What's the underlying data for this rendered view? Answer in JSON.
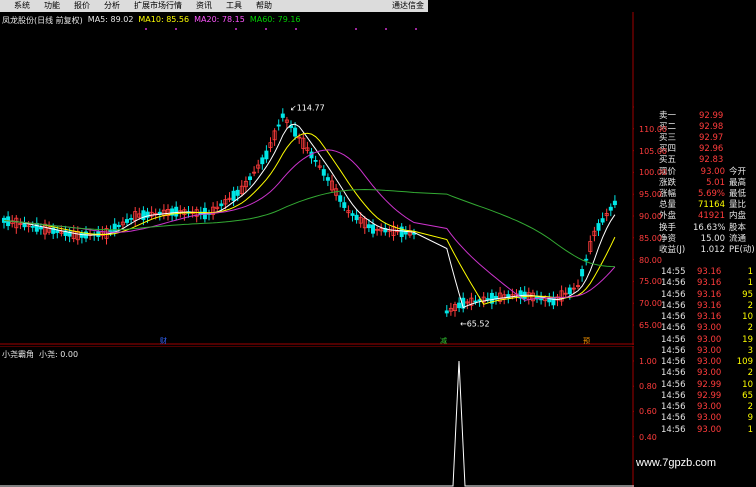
{
  "menu": {
    "items": [
      "系统",
      "功能",
      "报价",
      "分析",
      "扩展市场行情",
      "资讯",
      "工具",
      "帮助"
    ],
    "window_title": "通达信金"
  },
  "main_chart": {
    "title": "凤龙股份(日线 前复权)",
    "ma5": "MA5: 89.02",
    "ma10": "MA10: 85.56",
    "ma20": "MA20: 78.15",
    "ma60": "MA60: 79.16",
    "high_label": "114.77",
    "low_label": "65.52",
    "markers": [
      "财",
      "减",
      "预"
    ]
  },
  "sub_chart": {
    "title": "小尧霸角",
    "indicator": "小尧: 0.00"
  },
  "y_axis_main": [
    "115.00",
    "110.00",
    "105.00",
    "100.00",
    "95.00",
    "90.00",
    "85.00",
    "80.00",
    "75.00",
    "70.00",
    "65.00"
  ],
  "y_axis_sub": [
    "1.00",
    "0.80",
    "0.60",
    "0.40"
  ],
  "order_book": [
    {
      "label": "卖一",
      "price": "92.99"
    },
    {
      "label": "买二",
      "price": "92.98"
    },
    {
      "label": "买三",
      "price": "92.97"
    },
    {
      "label": "买四",
      "price": "92.96"
    },
    {
      "label": "买五",
      "price": "92.83"
    }
  ],
  "quote": [
    {
      "label": "现价",
      "value": "93.00",
      "label2": "今开",
      "c": "red"
    },
    {
      "label": "涨跌",
      "value": "5.01",
      "label2": "最高",
      "c": "red"
    },
    {
      "label": "涨幅",
      "value": "5.69%",
      "label2": "最低",
      "c": "red"
    },
    {
      "label": "总量",
      "value": "71164",
      "label2": "量比",
      "c": "yellow"
    },
    {
      "label": "外盘",
      "value": "41921",
      "label2": "内盘",
      "c": "red"
    },
    {
      "label": "换手",
      "value": "16.63%",
      "label2": "股本",
      "c": "white"
    },
    {
      "label": "净资",
      "value": "15.00",
      "label2": "流通",
      "c": "white"
    },
    {
      "label": "收益(J)",
      "value": "1.012",
      "label2": "PE(动)",
      "c": "white"
    }
  ],
  "ticks": [
    {
      "time": "14:55",
      "price": "93.16",
      "vol": "1"
    },
    {
      "time": "14:56",
      "price": "93.16",
      "vol": "1"
    },
    {
      "time": "14:56",
      "price": "93.16",
      "vol": "95"
    },
    {
      "time": "14:56",
      "price": "93.16",
      "vol": "2"
    },
    {
      "time": "14:56",
      "price": "93.16",
      "vol": "10"
    },
    {
      "time": "14:56",
      "price": "93.00",
      "vol": "2"
    },
    {
      "time": "14:56",
      "price": "93.00",
      "vol": "19"
    },
    {
      "time": "14:56",
      "price": "93.00",
      "vol": "3"
    },
    {
      "time": "14:56",
      "price": "93.00",
      "vol": "109"
    },
    {
      "time": "14:56",
      "price": "93.00",
      "vol": "2"
    },
    {
      "time": "14:56",
      "price": "92.99",
      "vol": "10"
    },
    {
      "time": "14:56",
      "price": "92.99",
      "vol": "65"
    },
    {
      "time": "14:56",
      "price": "93.00",
      "vol": "2"
    },
    {
      "time": "14:56",
      "price": "93.00",
      "vol": "9"
    },
    {
      "time": "14:56",
      "price": "93.00",
      "vol": "1"
    }
  ],
  "watermark": "www.7gpzb.com",
  "colors": {
    "up": "#ff3c3c",
    "down": "#00e6e6",
    "ma5": "#ffffff",
    "ma10": "#ffff00",
    "ma20": "#cc33cc",
    "ma60": "#33aa33"
  }
}
